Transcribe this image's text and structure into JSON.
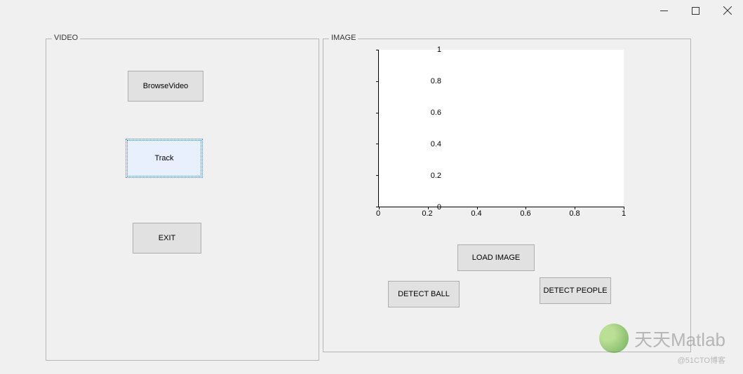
{
  "video_panel": {
    "label": "VIDEO",
    "browse_label": "BrowseVideo",
    "track_label": "Track",
    "exit_label": "EXIT"
  },
  "image_panel": {
    "label": "IMAGE",
    "load_label": "LOAD IMAGE",
    "detect_ball_label": "DETECT BALL",
    "detect_people_label": "DETECT PEOPLE"
  },
  "chart_data": {
    "type": "line",
    "categories": [],
    "values": [],
    "title": "",
    "xlabel": "",
    "ylabel": "",
    "xlim": [
      0,
      1
    ],
    "ylim": [
      0,
      1
    ],
    "x_ticks": [
      "0",
      "0.2",
      "0.4",
      "0.6",
      "0.8",
      "1"
    ],
    "y_ticks": [
      "0",
      "0.2",
      "0.4",
      "0.6",
      "0.8",
      "1"
    ]
  },
  "watermark": {
    "text": "天天Matlab",
    "credit": "@51CTO博客"
  }
}
